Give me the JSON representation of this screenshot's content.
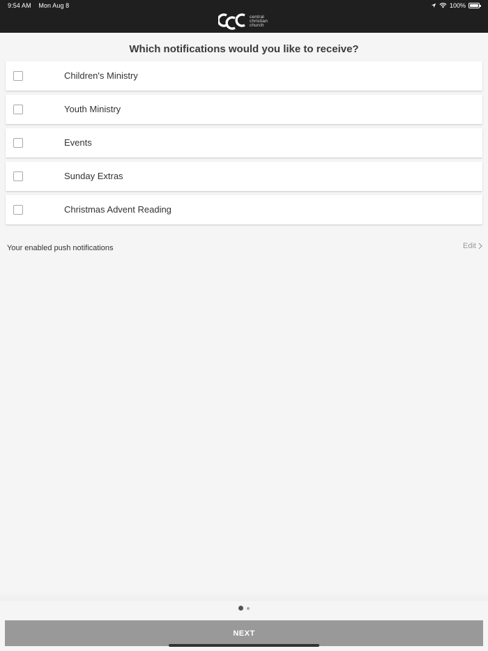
{
  "status_bar": {
    "time": "9:54 AM",
    "date": "Mon Aug 8",
    "battery": "100%",
    "icons": [
      "location-icon",
      "wifi-icon",
      "battery-icon"
    ]
  },
  "logo": {
    "mark": "CCC",
    "line1": "central",
    "line2": "christian",
    "line3": "church"
  },
  "question": "Which notifications would you like to receive?",
  "options": [
    {
      "label": "Children's Ministry",
      "checked": false
    },
    {
      "label": "Youth Ministry",
      "checked": false
    },
    {
      "label": "Events",
      "checked": false
    },
    {
      "label": "Sunday Extras",
      "checked": false
    },
    {
      "label": "Christmas Advent Reading",
      "checked": false
    }
  ],
  "enabled": {
    "text": "Your enabled push notifications",
    "edit_label": "Edit"
  },
  "pager": {
    "pages": 2,
    "current": 1
  },
  "next_label": "NEXT",
  "colors": {
    "header_bg": "#1f1f1f",
    "page_bg": "#f5f5f5",
    "next_button_bg": "#999999"
  }
}
